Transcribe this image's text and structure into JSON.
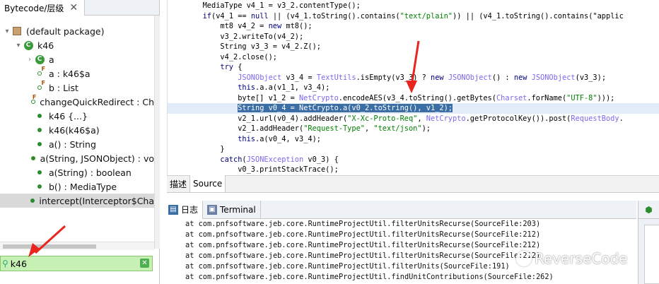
{
  "left_panel": {
    "tab_title": "Bytecode/层级",
    "tree": [
      {
        "label": "(default package)",
        "indent": 0,
        "expanded": true,
        "icon": "package-icon"
      },
      {
        "label": "k46",
        "indent": 1,
        "expanded": true,
        "icon": "class-icon"
      },
      {
        "label": "a",
        "indent": 2,
        "expanded": false,
        "icon": "class-icon"
      },
      {
        "label": "a : k46$a",
        "indent": 2,
        "icon": "field-icon"
      },
      {
        "label": "b : List",
        "indent": 2,
        "icon": "field-icon"
      },
      {
        "label": "changeQuickRedirect : Ch",
        "indent": 2,
        "icon": "field-icon"
      },
      {
        "label": "k46 {...}",
        "indent": 2,
        "icon": "method-icon"
      },
      {
        "label": "k46(k46$a)",
        "indent": 2,
        "icon": "method-icon"
      },
      {
        "label": "a() : String",
        "indent": 2,
        "icon": "method-icon"
      },
      {
        "label": "a(String, JSONObject) : vo",
        "indent": 2,
        "icon": "method-icon"
      },
      {
        "label": "a(String) : boolean",
        "indent": 2,
        "icon": "method-icon"
      },
      {
        "label": "b() : MediaType",
        "indent": 2,
        "icon": "method-icon"
      },
      {
        "label": "intercept(Interceptor$Cha",
        "indent": 2,
        "icon": "method-icon",
        "selected": true
      }
    ],
    "filter_value": "k46"
  },
  "code": {
    "lines": [
      "        MediaType v4_1 = v3_2.contentType();",
      "        if(v4_1 == null || (v4_1.toString().contains(\"text/plain\")) || (v4_1.toString().contains(\"applic",
      "            mt8 v4_2 = new mt8();",
      "            v3_2.writeTo(v4_2);",
      "            String v3_3 = v4_2.Z();",
      "            v4_2.close();",
      "            try {",
      "                JSONObject v3_4 = TextUtils.isEmpty(v3_3) ? new JSONObject() : new JSONObject(v3_3);",
      "                this.a.a(v1_1, v3_4);",
      "                byte[] v1_2 = NetCrypto.encodeAES(v3_4.toString().getBytes(Charset.forName(\"UTF-8\")));",
      "                String v0_4 = NetCrypto.a(v0_2.toString(), v1_2);",
      "                v2_1.url(v0_4).addHeader(\"X-Xc-Proto-Req\", NetCrypto.getProtocolKey()).post(RequestBody.",
      "                v2_1.addHeader(\"Request-Type\", \"text/json\");",
      "                this.a(v0_4, v3_4);",
      "            }",
      "            catch(JSONException v0_3) {",
      "                v0_3.printStackTrace();",
      "            }"
    ],
    "selected_line_index": 10
  },
  "view_tabs": [
    "描述",
    "Source"
  ],
  "console_tabs": [
    "日志",
    "Terminal"
  ],
  "console_lines": [
    "at com.pnfsoftware.jeb.core.RuntimeProjectUtil.filterUnitsRecurse(SourceFile:203)",
    "at com.pnfsoftware.jeb.core.RuntimeProjectUtil.filterUnitsRecurse(SourceFile:212)",
    "at com.pnfsoftware.jeb.core.RuntimeProjectUtil.filterUnitsRecurse(SourceFile:212)",
    "at com.pnfsoftware.jeb.core.RuntimeProjectUtil.filterUnitsRecurse(SourceFile:212)",
    "at com.pnfsoftware.jeb.core.RuntimeProjectUtil.filterUnits(SourceFile:191)",
    "at com.pnfsoftware.jeb.core.RuntimeProjectUtil.findUnitContributions(SourceFile:262)"
  ],
  "watermark": "ReverseCode",
  "colors": {
    "selection": "#3a6ea5",
    "filter_bg": "#c6f0b4",
    "arrow": "#e8251f",
    "string_literal": "#008000",
    "keyword": "#000080"
  }
}
